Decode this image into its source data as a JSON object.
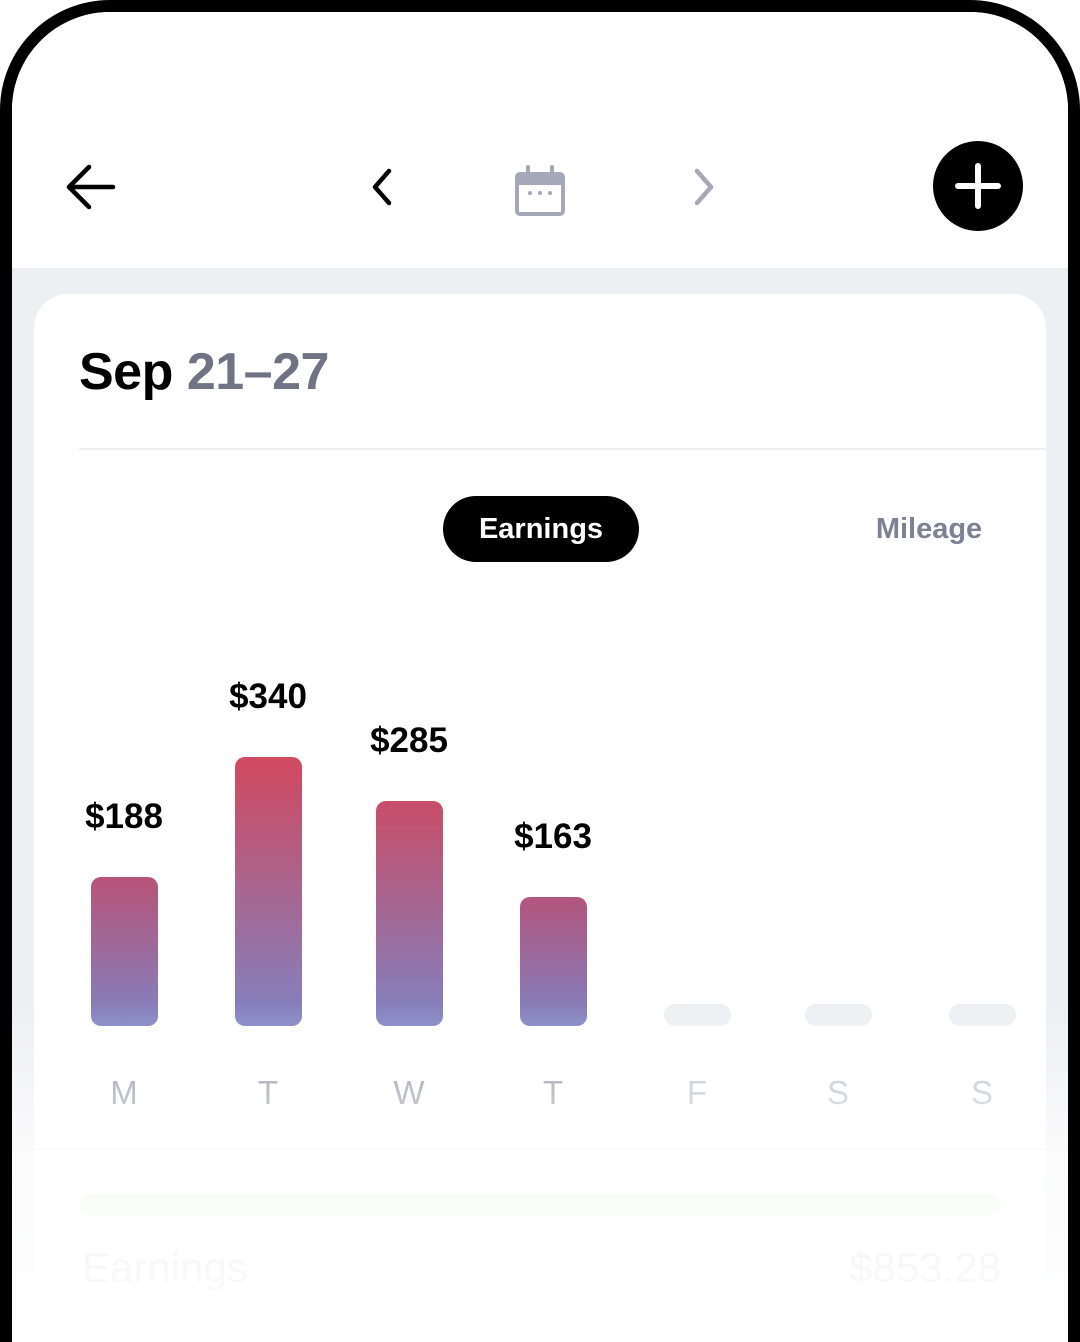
{
  "header": {
    "back_icon": "arrow-left-icon",
    "prev_icon": "chevron-left-icon",
    "calendar_icon": "calendar-icon",
    "next_icon": "chevron-right-icon",
    "add_icon": "plus-icon"
  },
  "week": {
    "month": "Sep",
    "range": "21–27"
  },
  "tabs": {
    "active": "Earnings",
    "inactive": "Mileage"
  },
  "chart_data": {
    "type": "bar",
    "categories": [
      "M",
      "T",
      "W",
      "T",
      "F",
      "S",
      "S"
    ],
    "values": [
      188,
      340,
      285,
      163,
      null,
      null,
      null
    ],
    "value_labels": [
      "$188",
      "$340",
      "$285",
      "$163",
      "",
      "",
      ""
    ],
    "colors": {
      "gradient_top_high": "#d1495f",
      "gradient_bottom": "#7f83c2",
      "empty_bar": "#eeeff3"
    }
  },
  "summary": {
    "label": "Earnings",
    "value": "$853.28",
    "progress_color": "#e3f2e2"
  }
}
